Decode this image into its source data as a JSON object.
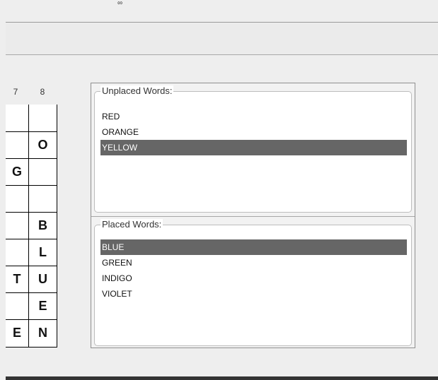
{
  "top_mark": "∞",
  "grid": {
    "column_numbers": [
      "7",
      "8"
    ],
    "cells": [
      {
        "row": 0,
        "col": 0,
        "letter": ""
      },
      {
        "row": 0,
        "col": 1,
        "letter": ""
      },
      {
        "row": 1,
        "col": 0,
        "letter": ""
      },
      {
        "row": 1,
        "col": 1,
        "letter": "O"
      },
      {
        "row": 2,
        "col": 0,
        "letter": "G"
      },
      {
        "row": 2,
        "col": 1,
        "letter": ""
      },
      {
        "row": 3,
        "col": 0,
        "letter": ""
      },
      {
        "row": 3,
        "col": 1,
        "letter": ""
      },
      {
        "row": 4,
        "col": 0,
        "letter": ""
      },
      {
        "row": 4,
        "col": 1,
        "letter": "B"
      },
      {
        "row": 5,
        "col": 0,
        "letter": ""
      },
      {
        "row": 5,
        "col": 1,
        "letter": "L"
      },
      {
        "row": 6,
        "col": 0,
        "letter": "T"
      },
      {
        "row": 6,
        "col": 1,
        "letter": "U"
      },
      {
        "row": 7,
        "col": 0,
        "letter": ""
      },
      {
        "row": 7,
        "col": 1,
        "letter": "E"
      },
      {
        "row": 8,
        "col": 0,
        "letter": "E"
      },
      {
        "row": 8,
        "col": 1,
        "letter": "N"
      }
    ]
  },
  "unplaced": {
    "title": "Unplaced Words:",
    "items": [
      {
        "label": "RED",
        "selected": false
      },
      {
        "label": "ORANGE",
        "selected": false
      },
      {
        "label": "YELLOW",
        "selected": true
      }
    ]
  },
  "placed": {
    "title": "Placed Words:",
    "items": [
      {
        "label": "BLUE",
        "selected": true
      },
      {
        "label": "GREEN",
        "selected": false
      },
      {
        "label": "INDIGO",
        "selected": false
      },
      {
        "label": "VIOLET",
        "selected": false
      }
    ]
  },
  "colors": {
    "selection_bg": "#666666",
    "selection_fg": "#ffffff",
    "window_bg": "#eeeeee"
  }
}
